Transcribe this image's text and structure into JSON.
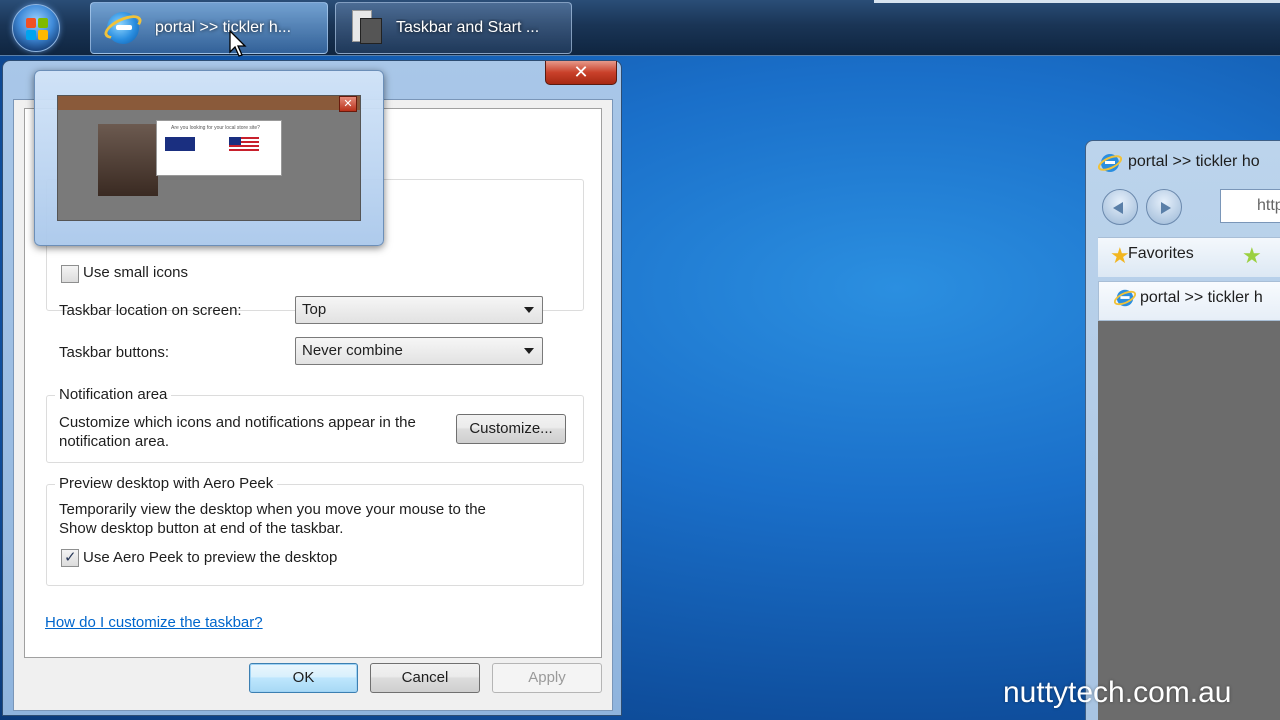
{
  "taskbar": {
    "buttons": [
      {
        "label": "portal >> tickler h...",
        "icon": "internet-explorer-icon",
        "state": "active"
      },
      {
        "label": "Taskbar and Start ...",
        "icon": "properties-document-icon",
        "state": "normal"
      }
    ]
  },
  "dialog": {
    "close_label": "✕",
    "use_small_icons_label": "Use small icons",
    "use_small_icons_checked": false,
    "location_label": "Taskbar location on screen:",
    "location_value": "Top",
    "buttons_label": "Taskbar buttons:",
    "buttons_value": "Never combine",
    "notification": {
      "title": "Notification area",
      "desc_line1": "Customize which icons and notifications appear in the",
      "desc_line2": "notification area.",
      "customize_label": "Customize..."
    },
    "aero_peek": {
      "title": "Preview desktop with Aero Peek",
      "desc_line1": "Temporarily view the desktop when you move your mouse to the",
      "desc_line2": "Show desktop button at end of the taskbar.",
      "checkbox_label": "Use Aero Peek to preview the desktop",
      "checked": true
    },
    "help_link": "How do I customize the taskbar?",
    "ok_label": "OK",
    "cancel_label": "Cancel",
    "apply_label": "Apply"
  },
  "thumbnail": {
    "close_label": "✕",
    "popup_text": "Are you looking for your local store site?"
  },
  "ie_window": {
    "title": "portal >> tickler ho",
    "address": "http",
    "favorites_label": "Favorites",
    "tab_label": "portal >> tickler h"
  },
  "watermark": "nuttytech.com.au",
  "colors": {
    "desktop": "#1a6fc9",
    "close_red": "#c9402a",
    "link_blue": "#0066cc"
  }
}
